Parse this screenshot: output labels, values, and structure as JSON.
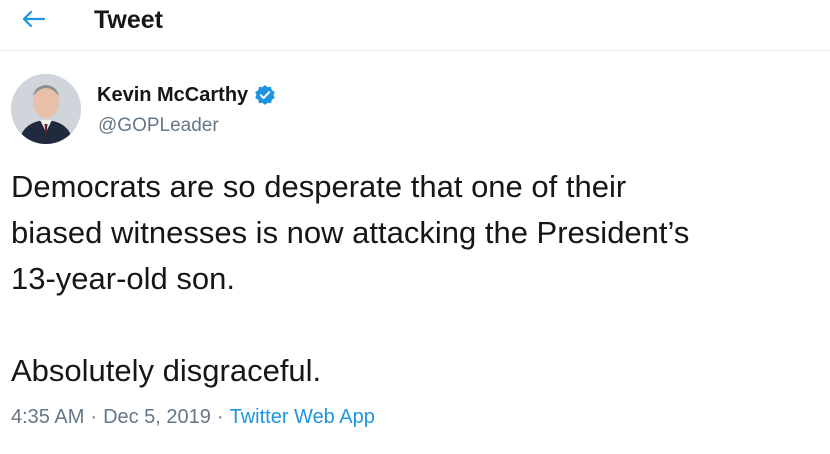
{
  "header": {
    "back_icon": "arrow-left-icon",
    "title": "Tweet"
  },
  "author": {
    "name": "Kevin McCarthy",
    "handle": "@GOPLeader",
    "verified_icon": "verified-badge-icon",
    "avatar_icon": "profile-photo"
  },
  "tweet": {
    "lines": [
      "Democrats are so desperate that one of their",
      "biased witnesses is now attacking the President’s",
      "13-year-old son.",
      "Absolutely disgraceful."
    ],
    "time": "4:35 AM",
    "separator": "·",
    "date": "Dec 5, 2019",
    "source": "Twitter Web App"
  },
  "colors": {
    "accent": "#1b95e0",
    "text": "#14171a",
    "muted": "#657786"
  }
}
